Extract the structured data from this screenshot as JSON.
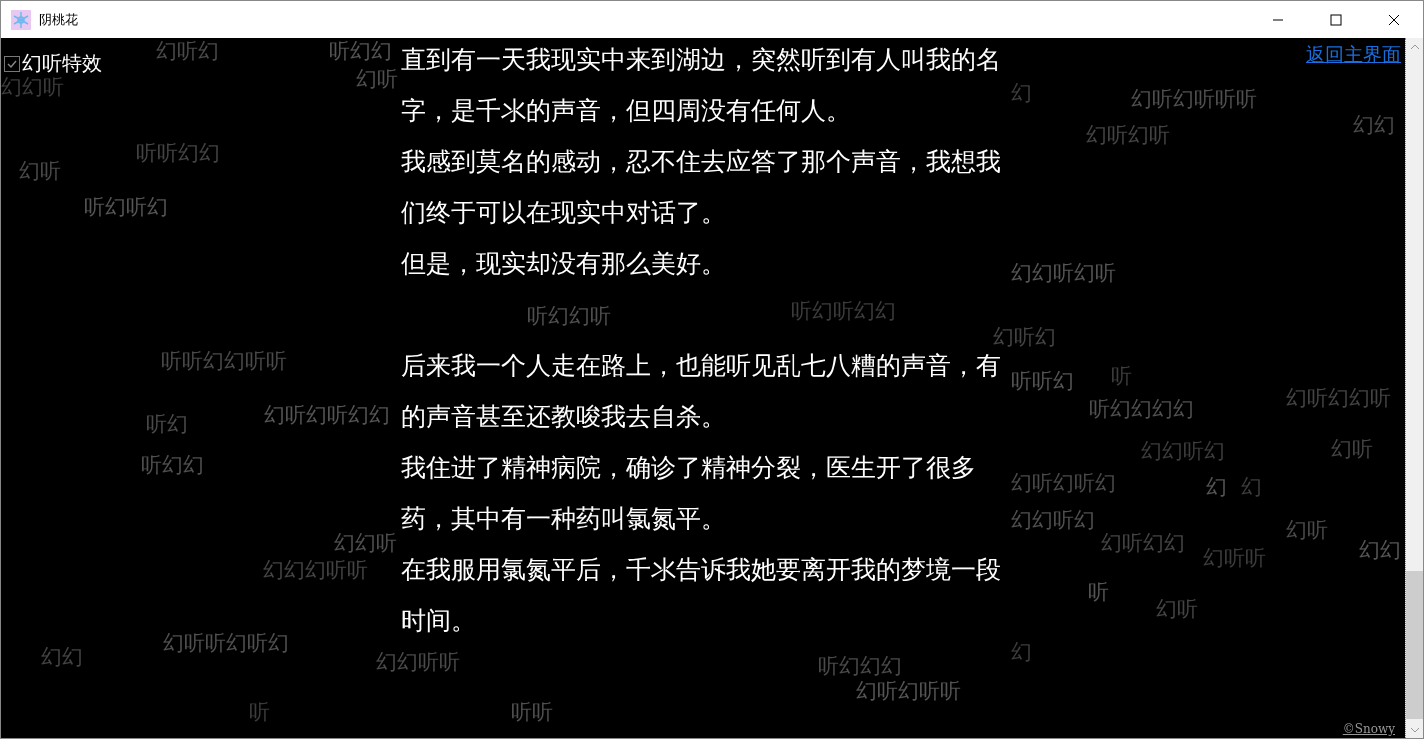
{
  "window": {
    "title": "阴桃花"
  },
  "effect_toggle": {
    "label": "幻听特效",
    "checked": true
  },
  "back_link": {
    "label": "返回主界面"
  },
  "sections": [
    {
      "paragraphs": [
        "直到有一天我现实中来到湖边，突然听到有人叫我的名字，是千氺的声音，但四周没有任何人。",
        "我感到莫名的感动，忍不住去应答了那个声音，我想我们终于可以在现实中对话了。",
        "但是，现实却没有那么美好。"
      ]
    },
    {
      "paragraphs": [
        "后来我一个人走在路上，也能听见乱七八糟的声音，有的声音甚至还教唆我去自杀。",
        "我住进了精神病院，确诊了精神分裂，医生开了很多药，其中有一种药叫氯氮平。",
        "在我服用氯氮平后，千氺告诉我她要离开我的梦境一段时间。"
      ]
    }
  ],
  "floating_words": [
    "幻听幻",
    "听幻幻",
    "幻幻听",
    "幻听",
    "听听幻幻",
    "幻听",
    "听幻听幻",
    "幻",
    "幻听幻听听听",
    "幻听幻听",
    "幻幻",
    "幻幻听幻听",
    "听幻听幻幻",
    "听幻幻听",
    "幻听幻",
    "听听幻幻听听",
    "听听幻",
    "听",
    "听幻幻幻幻",
    "幻听幻幻听",
    "听幻",
    "幻听幻听幻幻",
    "幻幻听幻",
    "听幻幻",
    "幻听",
    "幻听幻听幻",
    "幻",
    "幻",
    "幻幻听幻",
    "幻听幻幻",
    "幻听",
    "幻幻",
    "幻听听",
    "幻幻听",
    "幻幻幻听听",
    "听幻幻幻",
    "幻听幻听听",
    "幻",
    "幻听听幻听幻",
    "幻幻",
    "幻幻听听",
    "听",
    "听",
    "听听",
    "幻听"
  ],
  "credit_link": {
    "label": "©Snowy"
  }
}
